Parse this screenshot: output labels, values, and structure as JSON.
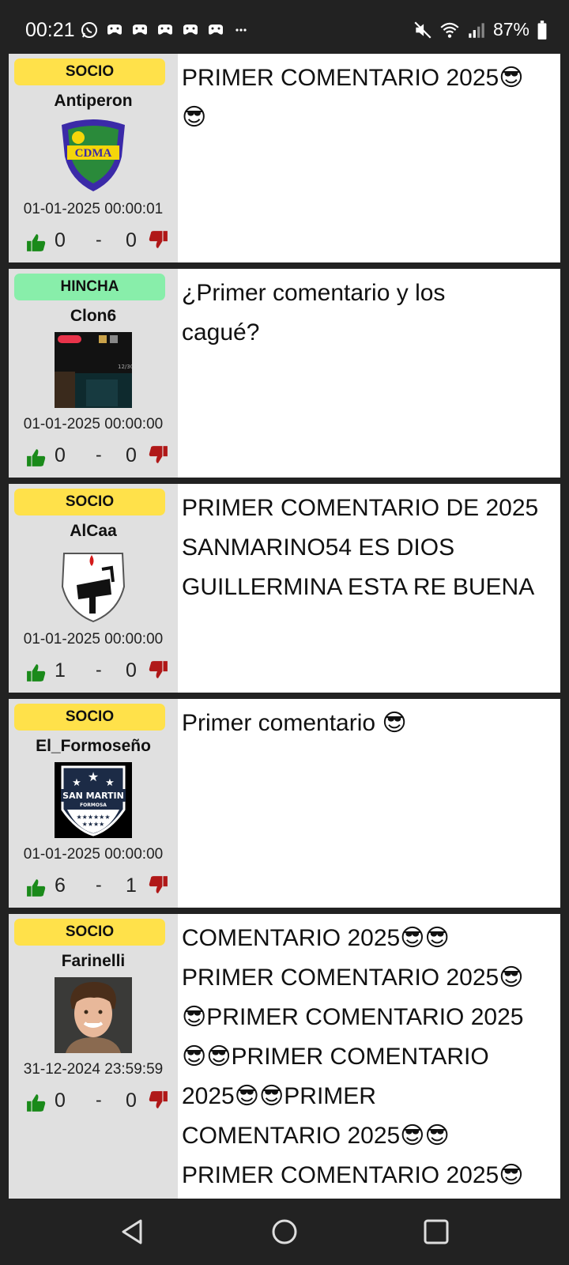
{
  "status_bar": {
    "time": "00:21",
    "battery": "87%",
    "notification_icons": [
      "whatsapp-icon",
      "game-controller-icon",
      "game-controller-icon",
      "game-controller-icon",
      "game-controller-icon",
      "game-controller-icon",
      "more-notifications-icon"
    ],
    "system_icons": [
      "mute-icon",
      "wifi-icon",
      "signal-icon",
      "battery-icon"
    ]
  },
  "comments": [
    {
      "badge": "SOCIO",
      "badge_type": "socio",
      "username": "Antiperon",
      "avatar": "club-crest-cdma",
      "date": "01-01-2025 00:00:01",
      "likes": "0",
      "separator": "-",
      "dislikes": "0",
      "text": "PRIMER COMENTARIO 2025😎\n😎"
    },
    {
      "badge": "HINCHA",
      "badge_type": "hincha",
      "username": "Clon6",
      "avatar": "screenshot-photo",
      "date": "01-01-2025 00:00:00",
      "likes": "0",
      "separator": "-",
      "dislikes": "0",
      "text": "¿Primer comentario y los\ncagué?"
    },
    {
      "badge": "SOCIO",
      "badge_type": "socio",
      "username": "AlCaa",
      "avatar": "club-crest-arabic",
      "date": "01-01-2025 00:00:00",
      "likes": "1",
      "separator": "-",
      "dislikes": "0",
      "text": "PRIMER COMENTARIO DE 2025\nSANMARINO54 ES DIOS\nGUILLERMINA ESTA RE BUENA"
    },
    {
      "badge": "SOCIO",
      "badge_type": "socio",
      "username": "El_Formoseño",
      "avatar": "club-crest-san-martin",
      "avatar_text": "SAN MARTIN",
      "avatar_subtext": "FORMOSA",
      "date": "01-01-2025 00:00:00",
      "likes": "6",
      "separator": "-",
      "dislikes": "1",
      "text": "Primer comentario 😎"
    },
    {
      "badge": "SOCIO",
      "badge_type": "socio",
      "username": "Farinelli",
      "avatar": "person-photo",
      "date": "31-12-2024 23:59:59",
      "likes": "0",
      "separator": "-",
      "dislikes": "0",
      "text": "COMENTARIO 2025😎😎\nPRIMER COMENTARIO 2025😎\n😎PRIMER COMENTARIO 2025\n😎😎PRIMER COMENTARIO\n2025😎😎PRIMER\nCOMENTARIO 2025😎😎\nPRIMER COMENTARIO 2025😎"
    }
  ],
  "nav_bar": {
    "buttons": [
      "back-icon",
      "home-icon",
      "recents-icon"
    ]
  },
  "colors": {
    "socio_badge": "#ffe14a",
    "hincha_badge": "#88eeaa",
    "thumb_up": "#1a8a1a",
    "thumb_down": "#b01818",
    "left_panel": "#e0e0e0",
    "separator": "#222222"
  }
}
